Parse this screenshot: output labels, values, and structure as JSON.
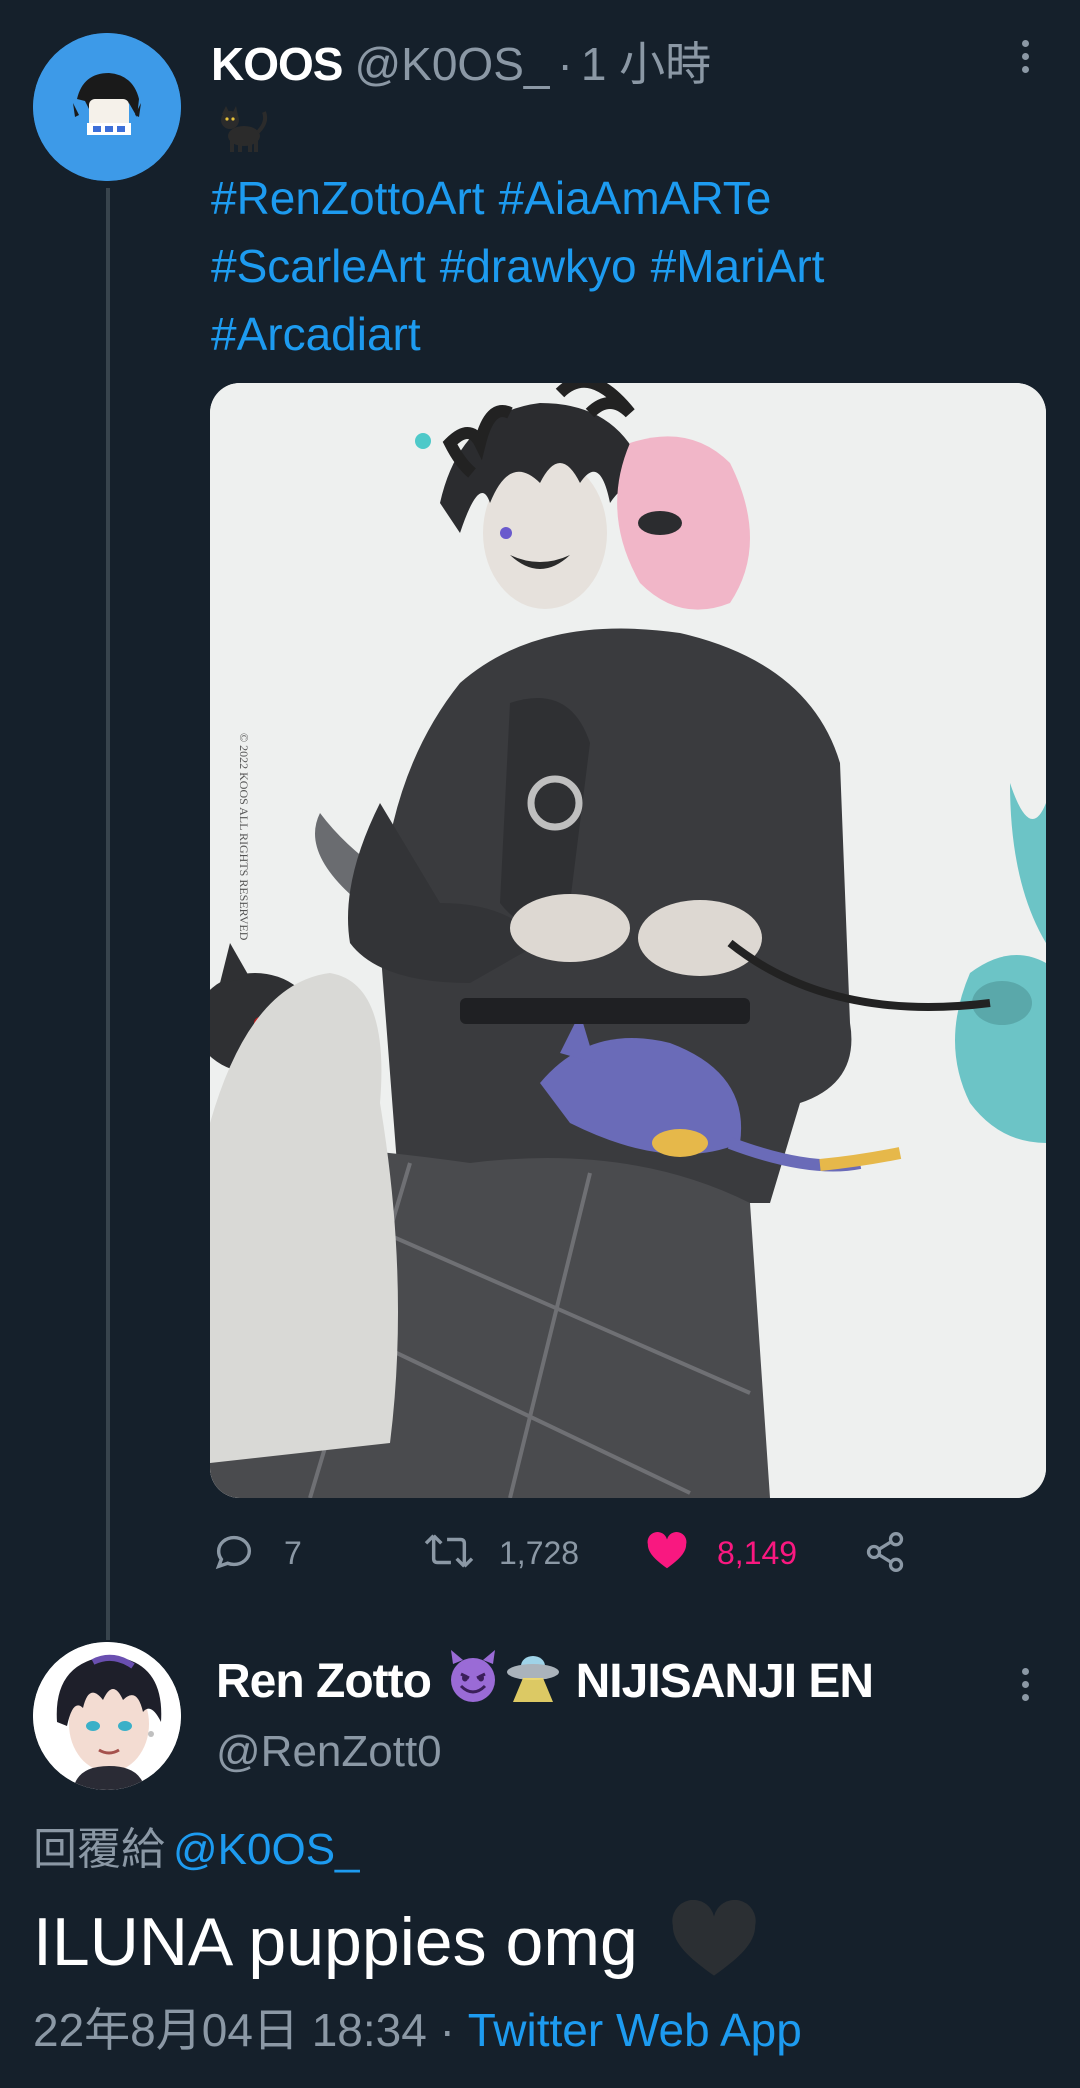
{
  "tweet": {
    "display_name": "KOOS",
    "handle": "@K0OS_",
    "separator": "·",
    "time": "1 小時",
    "hashtags": [
      "#RenZottoArt",
      "#AiaAmARTe",
      "#ScarleArt",
      "#drawkyo",
      "#MariArt",
      "#Arcadiart"
    ],
    "image_watermark": "© 2022 KOOS ALL RIGHTS RESERVED",
    "actions": {
      "reply_count": "7",
      "retweet_count": "1,728",
      "like_count": "8,149",
      "liked": true
    }
  },
  "reply": {
    "display_name": "Ren Zotto",
    "badge_text": "NIJISANJI EN",
    "emojis": [
      "smiling-devil-emoji",
      "ufo-emoji"
    ],
    "handle": "@RenZott0",
    "reply_to_label": "回覆給",
    "reply_to_handle": "@K0OS_",
    "text": "ILUNA puppies omg",
    "trailing_emoji": "black-heart-emoji",
    "date": "22年8月04日 18:34",
    "separator": "·",
    "source_app": "Twitter Web App"
  },
  "colors": {
    "background": "#15202b",
    "link": "#1d9bf0",
    "secondary_text": "#8b98a5",
    "like": "#f91880",
    "thread_line": "#38444d",
    "avatar_bg": "#3d9ae8"
  },
  "icons": {
    "reply": "reply-icon",
    "retweet": "retweet-icon",
    "like": "heart-filled-icon",
    "share": "share-icon",
    "more": "more-vertical-icon"
  }
}
